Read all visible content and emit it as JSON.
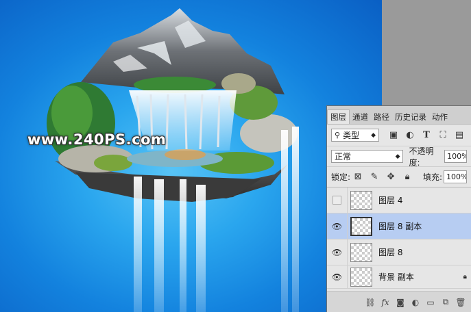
{
  "watermark": "www.240PS.com",
  "panel": {
    "tabs": [
      "图层",
      "通道",
      "路径",
      "历史记录",
      "动作"
    ],
    "filter_label": "类型",
    "blend_mode": "正常",
    "opacity_label": "不透明度:",
    "opacity_value": "100%",
    "lock_label": "锁定:",
    "fill_label": "填充:",
    "fill_value": "100%",
    "layers": [
      {
        "name": "图层 4",
        "visible": false,
        "selected": false
      },
      {
        "name": "图层 8 副本",
        "visible": true,
        "selected": true
      },
      {
        "name": "图层 8",
        "visible": true,
        "selected": false
      },
      {
        "name": "背景 副本",
        "visible": true,
        "selected": false
      }
    ],
    "footer_icons": [
      "link-layers-icon",
      "fx-icon",
      "mask-icon",
      "adjustment-icon",
      "group-icon",
      "new-layer-icon",
      "delete-icon"
    ]
  },
  "colors": {
    "canvas_blue": "#1382de",
    "selected_layer": "#b7cdf2",
    "panel_bg": "#e6e6e6"
  }
}
